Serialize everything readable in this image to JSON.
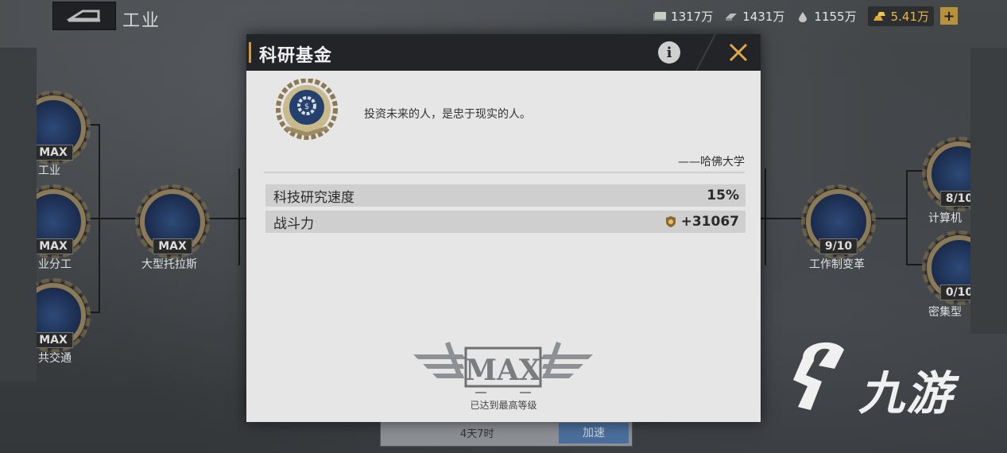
{
  "header": {
    "title": "工业",
    "resources": [
      {
        "icon": "cash-icon",
        "value": "1317万"
      },
      {
        "icon": "steel-icon",
        "value": "1431万"
      },
      {
        "icon": "oil-icon",
        "value": "1155万"
      },
      {
        "icon": "gold-bars-icon",
        "value": "5.41万"
      }
    ],
    "plus_label": "+"
  },
  "tech_tree": {
    "left_nodes": [
      {
        "level": "MAX",
        "label": "工业"
      },
      {
        "level": "MAX",
        "label": "业分工"
      },
      {
        "level": "MAX",
        "label": "共交通"
      }
    ],
    "center_node": {
      "level": "MAX",
      "label": "大型托拉斯"
    },
    "right_node": {
      "level": "9/10",
      "label": "工作制变革"
    },
    "far_right_nodes": [
      {
        "level": "8/10",
        "label": "计算机"
      },
      {
        "level": "0/10",
        "label": "密集型"
      }
    ]
  },
  "modal": {
    "title": "科研基金",
    "info_label": "i",
    "quote": "投资未来的人，是忠于现实的人。",
    "author": "——哈佛大学",
    "stats": [
      {
        "label": "科技研究速度",
        "value": "15%"
      },
      {
        "label": "战斗力",
        "value": "+31067"
      }
    ],
    "max_text": "MAX",
    "max_caption": "已达到最高等级"
  },
  "bottom_bar": {
    "timer": "4天7时",
    "button_label": "加速"
  },
  "watermark": {
    "text": "九游"
  }
}
